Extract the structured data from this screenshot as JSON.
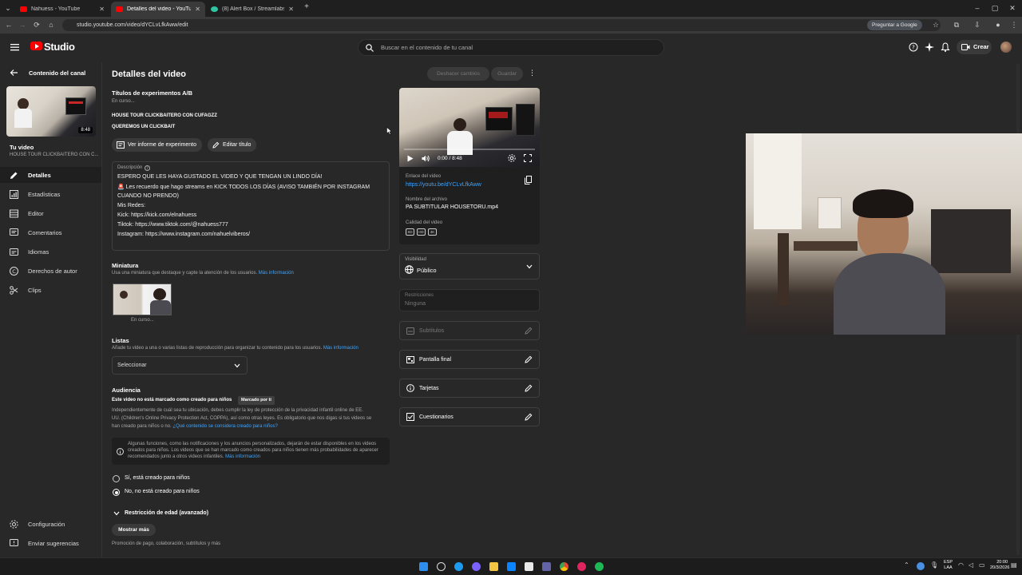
{
  "browser": {
    "tabs": [
      {
        "title": "Nahuess - YouTube",
        "active": false
      },
      {
        "title": "Detalles del video - YouTube St",
        "active": true
      },
      {
        "title": "(8) Alert Box / Streamlabs",
        "active": false
      }
    ],
    "new_tab": "+",
    "url": "studio.youtube.com/video/dYCLvLfkAww/edit",
    "ask_google": "Preguntar a Google"
  },
  "header": {
    "logo_text": "Studio",
    "search_placeholder": "Buscar en el contenido de tu canal",
    "create_label": "Crear"
  },
  "sidebar": {
    "back_label": "Contenido del canal",
    "thumb_duration": "8:48",
    "your_video_label": "Tu video",
    "your_video_title": "HOUSE TOUR CLICKBAITERO CON C...",
    "items": [
      {
        "label": "Detalles",
        "icon": "pencil-icon",
        "active": true
      },
      {
        "label": "Estadísticas",
        "icon": "analytics-icon",
        "active": false
      },
      {
        "label": "Editor",
        "icon": "film-editor-icon",
        "active": false
      },
      {
        "label": "Comentarios",
        "icon": "comments-icon",
        "active": false
      },
      {
        "label": "Idiomas",
        "icon": "subtitles-icon",
        "active": false
      },
      {
        "label": "Derechos de autor",
        "icon": "copyright-icon",
        "active": false
      },
      {
        "label": "Clips",
        "icon": "scissors-icon",
        "active": false
      }
    ],
    "settings_label": "Configuración",
    "feedback_label": "Enviar sugerencias"
  },
  "main": {
    "page_title": "Detalles del video",
    "undo_label": "Deshacer cambios",
    "save_label": "Guardar",
    "ab_title": "Títulos de experimentos A/B",
    "ab_status": "En curso...",
    "ab_titles": [
      "HOUSE TOUR CLICKBAITERO CON CUFAGZZ",
      "QUEREMOS UN CLICKBAIT"
    ],
    "report_button": "Ver informe de experimento",
    "edit_title_button": "Editar título",
    "description_label": "Descripción",
    "description_lines": [
      "ESPERO QUE LES HAYA GUSTADO EL VIDEO Y QUE TENGAN UN LINDO DÍA!",
      "🚨 Les recuerdo que hago streams en KICK TODOS LOS DÍAS (AVISO TAMBIÉN POR INSTAGRAM",
      "CUANDO NO PRENDO)",
      "Mis Redes:",
      "Kick: https://kick.com/elnahuess",
      "Tiktok: https://www.tiktok.com/@nahuess777",
      "Instagram: https://www.instagram.com/nahuelviberos/"
    ],
    "thumbnail_title": "Miniatura",
    "thumbnail_help": "Usa una miniatura que destaque y capte la atención de los usuarios.",
    "more_info": "Más información",
    "thumbnail_status": "En curso...",
    "lists_title": "Listas",
    "lists_help": "Añade tu video a una o varias listas de reproducción para organizar tu contenido para los usuarios.",
    "lists_select": "Seleccionar",
    "audience_title": "Audiencia",
    "audience_status": "Este video no está marcado como creado para niños",
    "audience_badge": "Marcado por ti",
    "audience_text_1": "Independientemente de cuál sea tu ubicación, debes cumplir la ley de protección de la privacidad infantil online de EE.",
    "audience_text_2": "UU. (Children's Online Privacy Protection Act, COPPA), así como otras leyes. Es obligatorio que nos digas si tus videos se",
    "audience_text_3": "han creado para niños o no.",
    "audience_link": "¿Qué contenido se considera creado para niños?",
    "info_text_1": "Algunas funciones, como las notificaciones y los anuncios personalizados, dejarán de estar disponibles en los videos",
    "info_text_2": "creados para niños. Los videos que se han marcado como creados para niños tienen más probabilidades de aparecer",
    "info_text_3": "recomendados junto a otros videos infantiles.",
    "radio_yes": "Sí, está creado para niños",
    "radio_no": "No, no está creado para niños",
    "age_restriction": "Restricción de edad (avanzado)",
    "show_more": "Mostrar más",
    "show_more_help": "Promoción de pago, colaboración, subtítulos y más"
  },
  "right": {
    "player_time": "0:00 / 8:48",
    "link_label": "Enlace del video",
    "link_value": "https://youtu.be/dYCLvLfkAww",
    "filename_label": "Nombre del archivo",
    "filename_value": "PA SUBTITULAR HOUSETORU.mp4",
    "quality_label": "Calidad del video",
    "quality_badges": [
      "SD",
      "HD",
      "4K"
    ],
    "visibility_label": "Visibilidad",
    "visibility_value": "Público",
    "restrictions_label": "Restricciones",
    "restrictions_value": "Ninguna",
    "subtitles_label": "Subtítulos",
    "end_screen_label": "Pantalla final",
    "cards_label": "Tarjetas",
    "quizzes_label": "Cuestionarios"
  },
  "taskbar": {
    "lang": "ESP",
    "lang2": "LAA",
    "time": "20:00",
    "date": "20/3/2026"
  }
}
